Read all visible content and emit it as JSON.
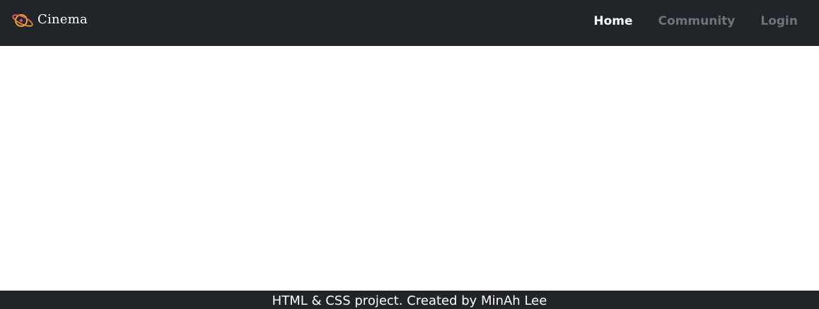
{
  "navbar": {
    "brand": {
      "text": "Cinema",
      "logo_icon": "planet-icon"
    },
    "links": [
      {
        "label": "Home",
        "active": true
      },
      {
        "label": "Community",
        "active": false
      },
      {
        "label": "Login",
        "active": false
      }
    ]
  },
  "footer": {
    "text": "HTML & CSS project. Created by MinAh Lee"
  },
  "colors": {
    "navbar_bg": "#212529",
    "nav_active": "#ffffff",
    "nav_inactive": "#6c757d",
    "logo_orange": "#f5a623",
    "logo_pink": "#e0457b"
  }
}
